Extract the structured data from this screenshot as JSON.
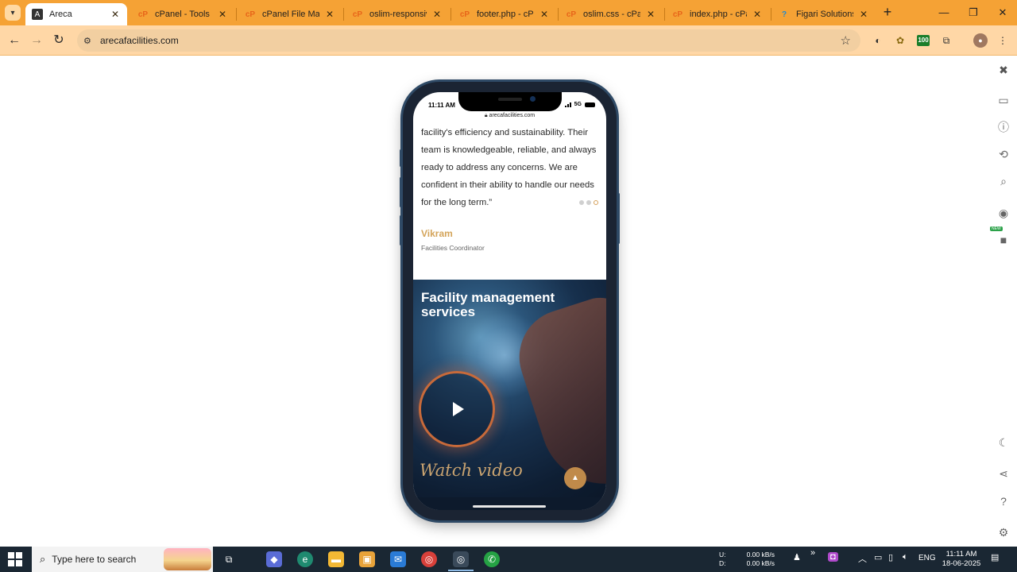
{
  "browser": {
    "tabs": [
      {
        "title": "Areca",
        "favicon": "areca-logo",
        "active": true
      },
      {
        "title": "cPanel - Tools",
        "favicon": "cpanel-logo"
      },
      {
        "title": "cPanel File Manag",
        "favicon": "cpanel-logo"
      },
      {
        "title": "oslim-responsive.c",
        "favicon": "cpanel-logo"
      },
      {
        "title": "footer.php - cPane",
        "favicon": "cpanel-logo"
      },
      {
        "title": "oslim.css - cPanel",
        "favicon": "cpanel-logo"
      },
      {
        "title": "index.php - cPane",
        "favicon": "cpanel-logo"
      },
      {
        "title": "Figari Solutions - (",
        "favicon": "figari-logo"
      }
    ],
    "address": "arecafacilities.com",
    "extension_badge": "100",
    "accent_color": "#f5a235",
    "toolbar_color": "#ffd7a6"
  },
  "phone": {
    "status_time": "11:11 AM",
    "status_network": "5G",
    "mini_url": "arecafacilities.com",
    "testimonial": {
      "quote": "facility's efficiency and sustainability. Their team is knowledgeable, reliable, and always ready to address any concerns. We are confident in their ability to handle our needs for the long term.”",
      "author": "Vikram",
      "role": "Facilities Coordinator",
      "carousel_dots": 3,
      "active_dot": 3
    },
    "video": {
      "title": "Facility management services",
      "cta": "Watch video"
    },
    "brand_color": "#d4a45a"
  },
  "taskbar": {
    "search_placeholder": "Type here to search",
    "net_up_label": "U:",
    "net_down_label": "D:",
    "net_up": "0.00 kB/s",
    "net_down": "0.00 kB/s",
    "language": "ENG",
    "time": "11:11 AM",
    "date": "18-06-2025"
  }
}
